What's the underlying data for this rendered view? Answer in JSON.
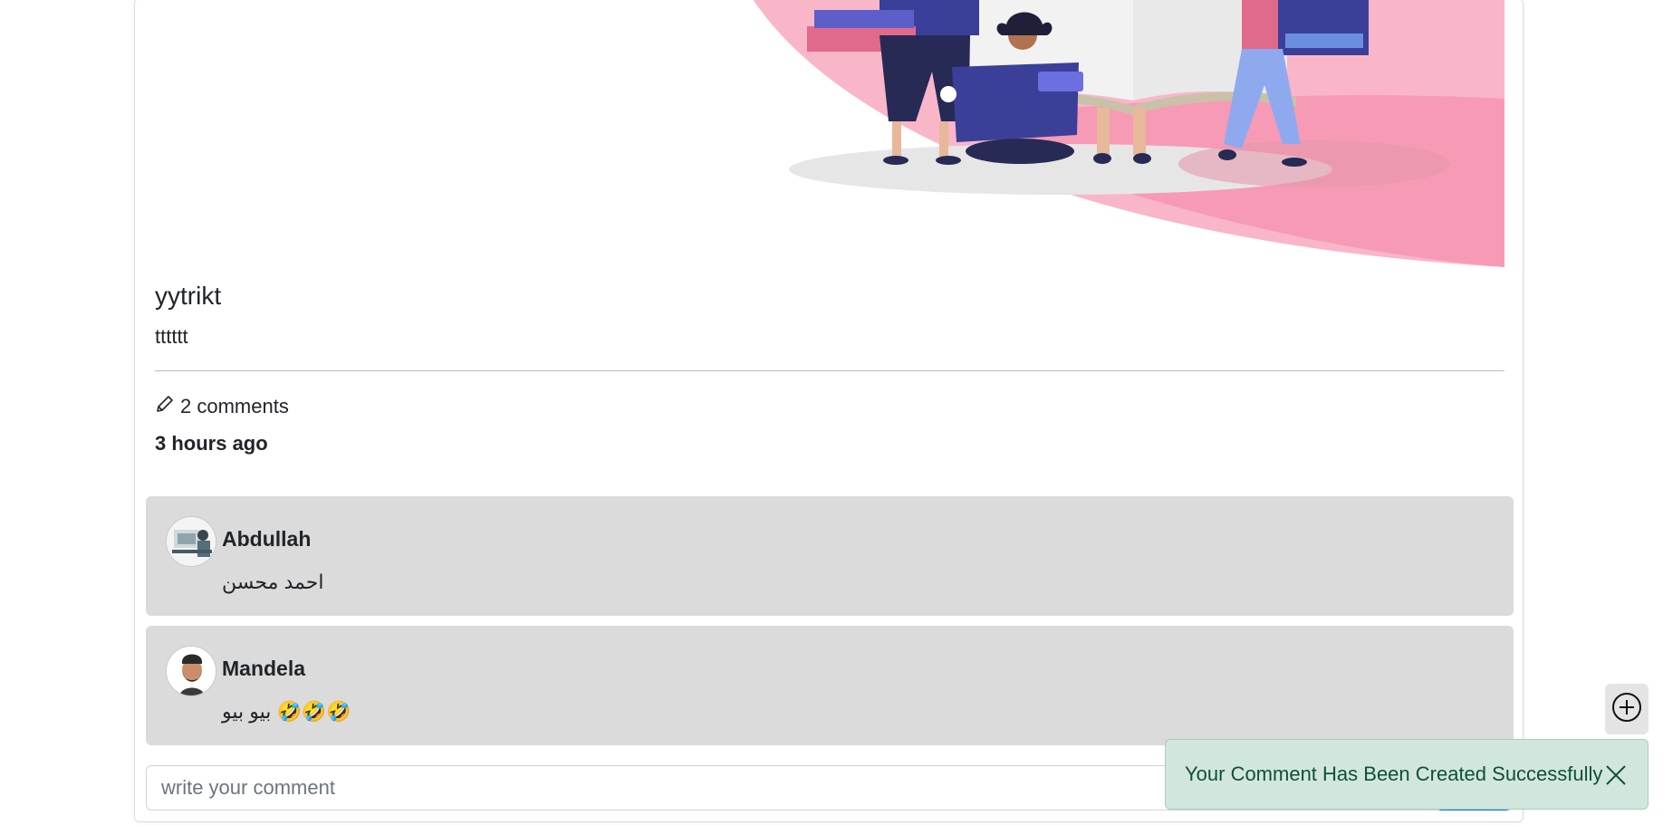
{
  "post": {
    "title": "yytrikt",
    "body": "tttttt",
    "comments_count": "2 comments",
    "time_ago": "3 hours ago"
  },
  "comments": [
    {
      "author": "Abdullah",
      "text": "احمد محسن"
    },
    {
      "author": "Mandela",
      "text": "بيو بيو 🤣🤣🤣"
    }
  ],
  "comment_input": {
    "placeholder": "write your comment"
  },
  "toast": {
    "message": "Your Comment Has Been Created Successfully"
  },
  "icons": {
    "pencil": "pencil-icon",
    "add": "plus-circle-icon",
    "close": "close-icon"
  },
  "colors": {
    "comment_bg": "#dbdbdb",
    "toast_bg": "#d1e7dd",
    "toast_text": "#0f5132",
    "illustration_pink": "#f78fb0",
    "illustration_indigo": "#3b3f9a"
  }
}
